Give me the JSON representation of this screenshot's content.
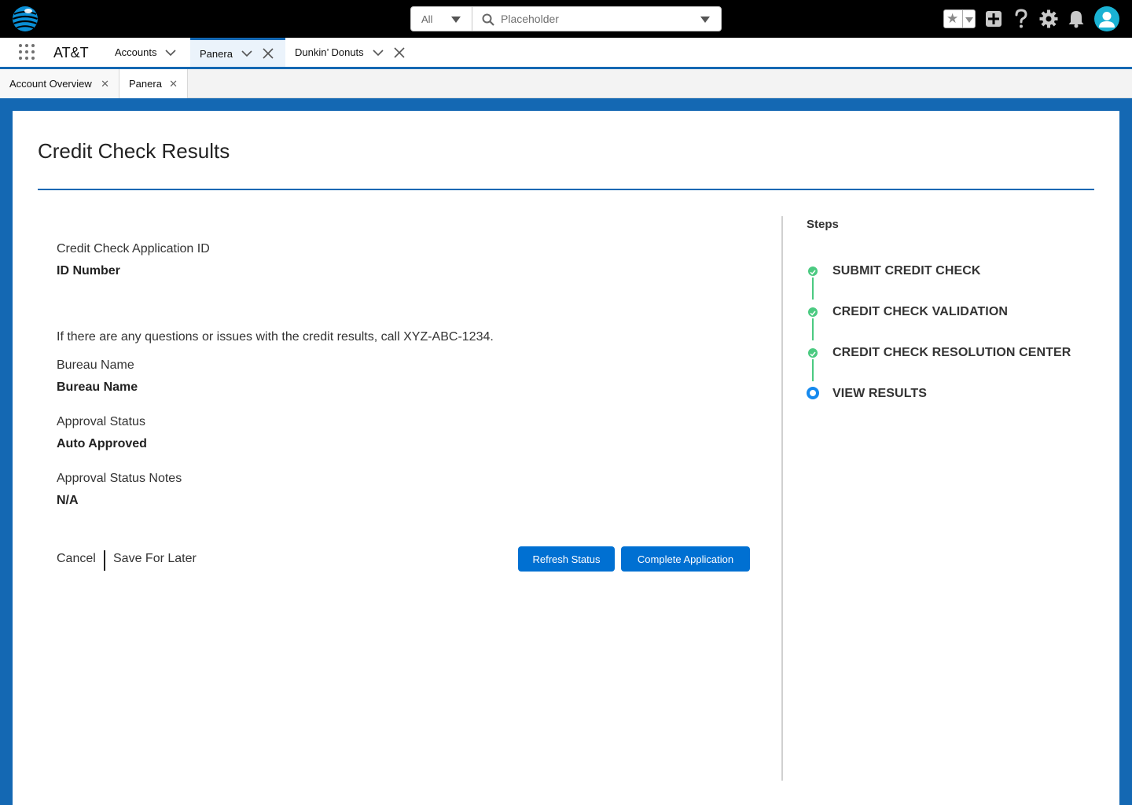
{
  "header": {
    "search_scope": "All",
    "search_placeholder": "Placeholder"
  },
  "nav": {
    "app_name": "AT&T",
    "tabs": [
      {
        "label": "Accounts"
      },
      {
        "label": "Panera"
      },
      {
        "label": "Dunkin’ Donuts"
      }
    ]
  },
  "subtabs": [
    {
      "label": "Account Overview"
    },
    {
      "label": "Panera"
    }
  ],
  "main": {
    "title": "Credit Check Results",
    "app_id_label": "Credit Check Application ID",
    "app_id_value": "ID Number",
    "info_text": "If there are any questions or issues with the credit results, call XYZ-ABC-1234.",
    "bureau_label": "Bureau Name",
    "bureau_value": "Bureau Name",
    "approval_label": "Approval Status",
    "approval_value": "Auto Approved",
    "notes_label": "Approval Status Notes",
    "notes_value": "N/A",
    "cancel_label": "Cancel",
    "save_label": "Save For Later",
    "refresh_label": "Refresh Status",
    "complete_label": "Complete Application"
  },
  "steps": {
    "title": "Steps",
    "items": [
      {
        "label": "SUBMIT CREDIT CHECK",
        "status": "complete"
      },
      {
        "label": "CREDIT CHECK VALIDATION",
        "status": "complete"
      },
      {
        "label": "CREDIT CHECK RESOLUTION CENTER",
        "status": "complete"
      },
      {
        "label": "VIEW RESULTS",
        "status": "current"
      }
    ]
  },
  "colors": {
    "brand_blue": "#1468b3",
    "button_blue": "#0070d2",
    "step_complete": "#4bca81",
    "step_current": "#1589ee",
    "avatar": "#1ab2d3"
  }
}
